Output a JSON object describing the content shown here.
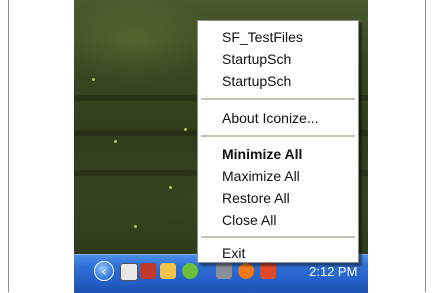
{
  "menu": {
    "items": [
      {
        "label": "SF_TestFiles",
        "bold": false
      },
      {
        "label": "StartupSch",
        "bold": false
      },
      {
        "label": "StartupSch",
        "bold": false
      },
      {
        "label": "About Iconize...",
        "bold": false
      },
      {
        "label": "Minimize All",
        "bold": true
      },
      {
        "label": "Maximize All",
        "bold": false
      },
      {
        "label": "Restore All",
        "bold": false
      },
      {
        "label": "Close All",
        "bold": false
      },
      {
        "label": "Exit",
        "bold": false
      }
    ]
  },
  "taskbar": {
    "clock": "2:12 PM",
    "expand_glyph": "‹",
    "tray_icons": [
      "network-icon",
      "tools-icon",
      "folder-icon",
      "arrow-icon",
      "printer-icon",
      "media-icon",
      "antivirus-icon"
    ]
  },
  "colors": {
    "menu_background": "#ffffff",
    "taskbar_blue": "#2e6fd6",
    "desktop_green": "#3a4a22"
  }
}
